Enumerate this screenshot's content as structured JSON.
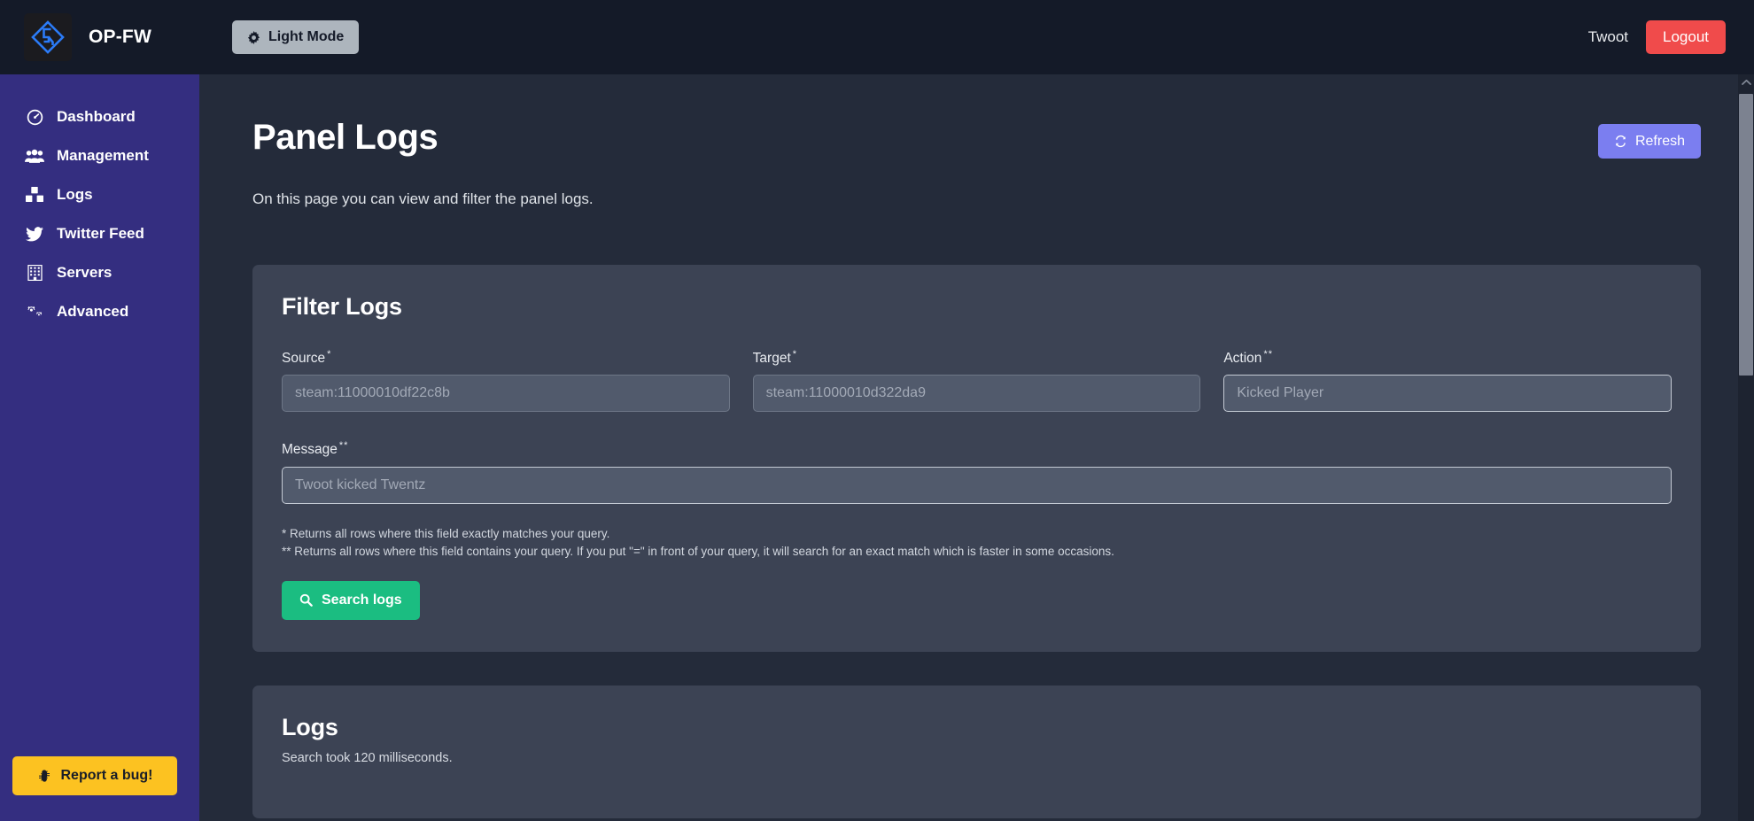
{
  "topbar": {
    "brand_name": "OP-FW",
    "logo_icon": "opfw-diamond-logo",
    "light_mode_label": "Light Mode",
    "light_mode_icon": "gear-icon",
    "user_name": "Twoot",
    "logout_label": "Logout"
  },
  "sidebar": {
    "items": [
      {
        "label": "Dashboard",
        "icon": "gauge-icon"
      },
      {
        "label": "Management",
        "icon": "users-icon"
      },
      {
        "label": "Logs",
        "icon": "boxes-icon"
      },
      {
        "label": "Twitter Feed",
        "icon": "twitter-bird-icon"
      },
      {
        "label": "Servers",
        "icon": "building-grid-icon"
      },
      {
        "label": "Advanced",
        "icon": "cogs-icon"
      }
    ],
    "bug_button": {
      "label": "Report a bug!",
      "icon": "bug-icon"
    }
  },
  "page": {
    "title": "Panel Logs",
    "subtitle": "On this page you can view and filter the panel logs.",
    "refresh_label": "Refresh",
    "refresh_icon": "refresh-sync-icon"
  },
  "filter_card": {
    "title": "Filter Logs",
    "fields": [
      {
        "label": "Source",
        "marker": "*",
        "value": "",
        "placeholder": "steam:11000010df22c8b",
        "highlight": false
      },
      {
        "label": "Target",
        "marker": "*",
        "value": "",
        "placeholder": "steam:11000010d322da9",
        "highlight": false
      },
      {
        "label": "Action",
        "marker": "**",
        "value": "",
        "placeholder": "Kicked Player",
        "highlight": true
      },
      {
        "label": "Message",
        "marker": "**",
        "value": "",
        "placeholder": "Twoot kicked Twentz",
        "highlight": true
      }
    ],
    "hint_single": "* Returns all rows where this field exactly matches your query.",
    "hint_double": "** Returns all rows where this field contains your query. If you put \"=\" in front of your query, it will search for an exact match which is faster in some occasions.",
    "search_label": "Search logs",
    "search_icon": "magnifier-icon"
  },
  "logs_card": {
    "title": "Logs",
    "meta": "Search took 120 milliseconds."
  },
  "scrollbar": {
    "up_icon": "chevron-up-icon",
    "down_icon": "chevron-down-icon"
  },
  "colors": {
    "sidebar": "#342e80",
    "topbar": "#141a28",
    "page_bg": "#242b3a",
    "card_bg": "#3c4354",
    "accent_refresh": "#7b7ef0",
    "accent_search": "#1bbd81",
    "accent_logout": "#f04b4b",
    "accent_bug": "#fcc221"
  }
}
